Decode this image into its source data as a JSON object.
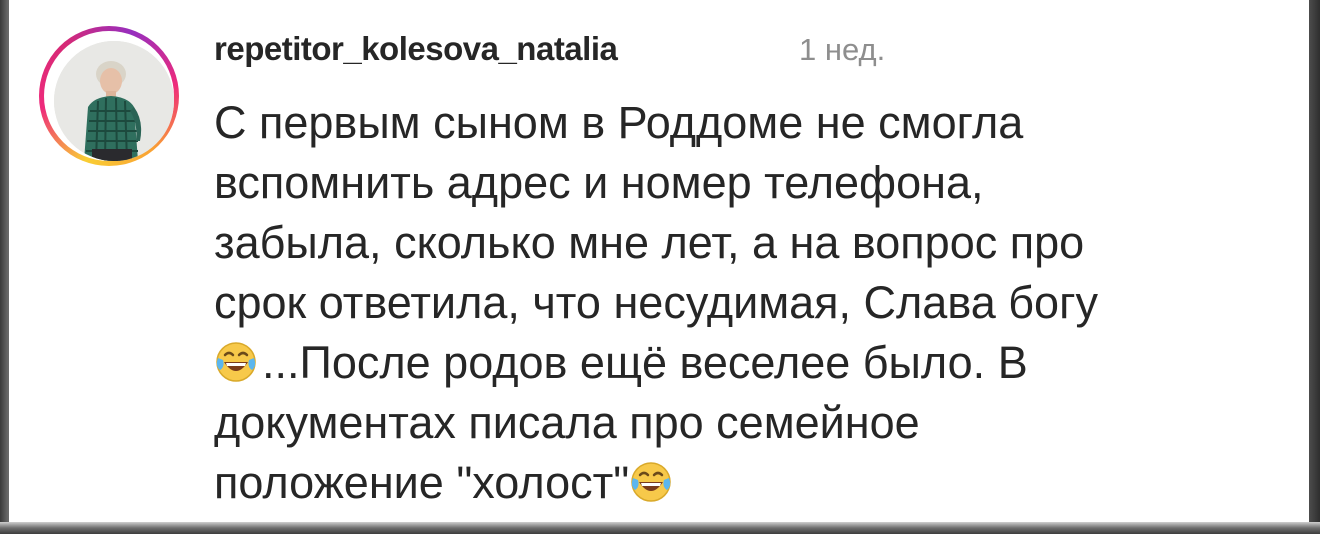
{
  "comment": {
    "username": "repetitor_kolesova_natalia",
    "timestamp": "1 нед.",
    "lines": [
      "С первым сыном в Роддоме не смогла",
      "вспомнить адрес и номер телефона,",
      "забыла, сколько мне лет,  а на вопрос про",
      "срок ответила, что несудимая, Слава богу",
      "...После родов ещё веселее было. В",
      "документах писала про семейное",
      "положение \"холост\""
    ],
    "emoji_icon": "face-with-tears-of-joy-icon"
  },
  "colors": {
    "text": "#262626",
    "muted": "#8e8e8e",
    "story_ring": [
      "#f9ce34",
      "#ee2a7b",
      "#962fbf"
    ]
  }
}
